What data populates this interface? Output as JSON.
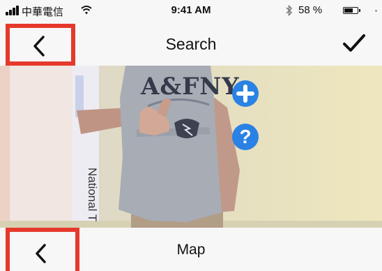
{
  "status_bar": {
    "carrier": "中華電信",
    "time": "9:41 AM",
    "battery_percent": "58 %",
    "battery_level": 0.58,
    "icons": [
      "signal-icon",
      "wifi-icon",
      "bluetooth-icon",
      "battery-icon"
    ]
  },
  "nav_bar": {
    "title": "Search",
    "left_icon": "chevron-left-icon",
    "right_icon": "checkmark-icon"
  },
  "camera_view": {
    "shirt_text": "A&FNY",
    "wall_sign_text": "National T",
    "overlay_buttons": [
      "plus-icon",
      "question-icon"
    ],
    "help_glyph": "?"
  },
  "bottom_bar": {
    "title": "Map",
    "left_icon": "chevron-left-icon"
  },
  "colors": {
    "accent_blue": "#2a82e4",
    "highlight_red": "#e5392b",
    "bar_background": "#f7f7f7"
  }
}
